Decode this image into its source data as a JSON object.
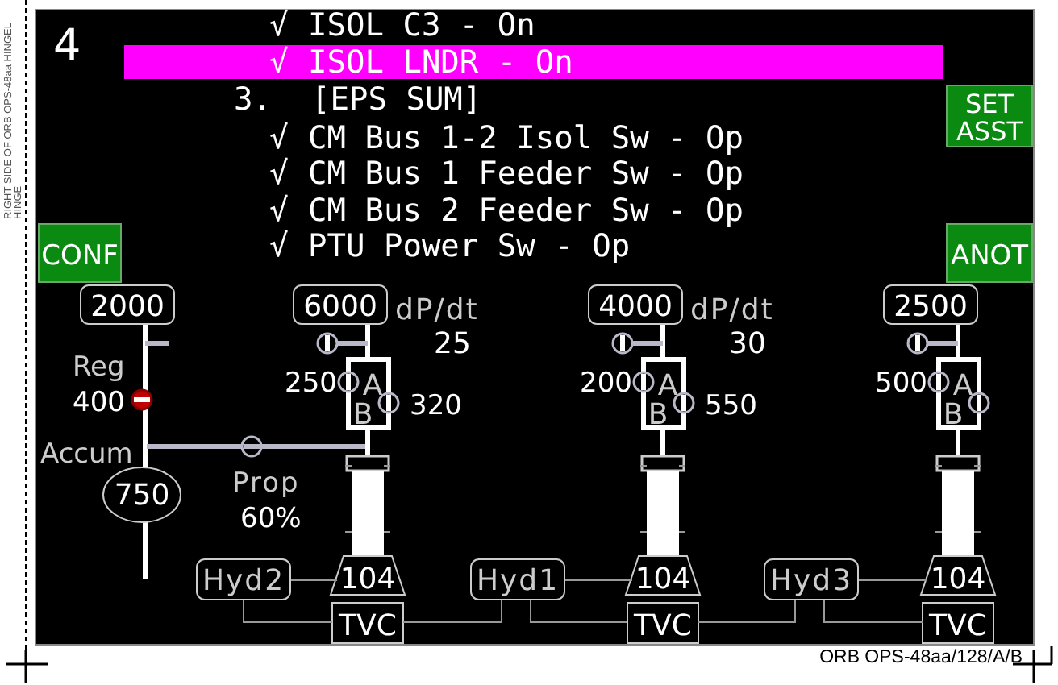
{
  "page": {
    "side_note": [
      "RIGHT SIDE OF ORB OPS-48aa HINGEL",
      "HINGE"
    ],
    "footer": "ORB OPS-48aa/128/A/B"
  },
  "display": {
    "number": "4",
    "checklist": [
      {
        "kind": "step",
        "mark": "√",
        "text": "ISOL C3 - On",
        "selected": false
      },
      {
        "kind": "step",
        "mark": "√",
        "text": "ISOL LNDR - On",
        "selected": true
      },
      {
        "kind": "heading",
        "mark": "3.",
        "text": "[EPS SUM]",
        "selected": false
      },
      {
        "kind": "step",
        "mark": "√",
        "text": "CM Bus 1-2 Isol Sw - Op",
        "selected": false
      },
      {
        "kind": "step",
        "mark": "√",
        "text": "CM Bus 1 Feeder Sw - Op",
        "selected": false
      },
      {
        "kind": "step",
        "mark": "√",
        "text": "CM Bus 2 Feeder Sw - Op",
        "selected": false
      },
      {
        "kind": "step",
        "mark": "√",
        "text": "PTU Power Sw - Op",
        "selected": false
      }
    ],
    "buttons": [
      {
        "lines": [
          "SET",
          "ASST"
        ]
      },
      {
        "lines": [
          "CONF"
        ]
      },
      {
        "lines": [
          "ANOT"
        ]
      }
    ],
    "supply": {
      "pressure": "2000",
      "reg_label": "Reg",
      "reg_value": "400",
      "reg_valve": {
        "open": false,
        "alert": true
      },
      "accum_label": "Accum",
      "accum_value": "750",
      "prop_label": "Prop",
      "prop_value": "60%",
      "prop_valve": {
        "open": false,
        "alert": false
      }
    },
    "systems": [
      {
        "pressure": "6000",
        "dpdt_label": "dP/dt",
        "dpdt": "25",
        "a_label": "A",
        "b_label": "B",
        "a_reading": "250",
        "b_reading": "320",
        "hyd": "Hyd2",
        "nozzle": "104",
        "tvc": "TVC"
      },
      {
        "pressure": "4000",
        "dpdt_label": "dP/dt",
        "dpdt": "30",
        "a_label": "A",
        "b_label": "B",
        "a_reading": "200",
        "b_reading": "550",
        "hyd": "Hyd1",
        "nozzle": "104",
        "tvc": "TVC"
      },
      {
        "pressure": "2500",
        "a_label": "A",
        "b_label": "B",
        "a_reading": "500",
        "hyd": "Hyd3",
        "nozzle": "104",
        "tvc": "TVC"
      }
    ]
  }
}
